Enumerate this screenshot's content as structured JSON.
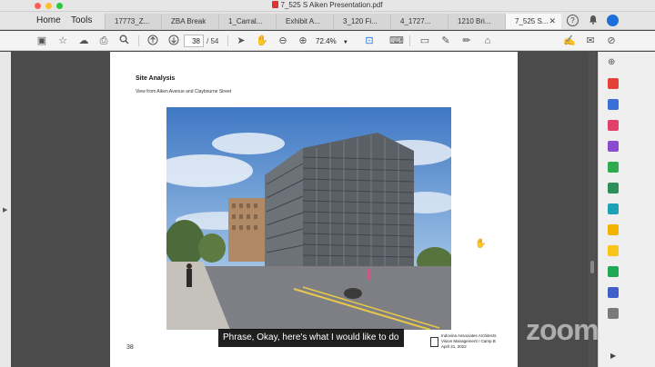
{
  "window": {
    "title": "7_525 S Aiken Presentation.pdf"
  },
  "nav": {
    "home": "Home",
    "tools": "Tools"
  },
  "tabs": [
    {
      "label": "17773_Z..."
    },
    {
      "label": "ZBA Break"
    },
    {
      "label": "1_Carral..."
    },
    {
      "label": "Exhibit A..."
    },
    {
      "label": "3_120 Fi..."
    },
    {
      "label": "4_1727..."
    },
    {
      "label": "1210 Bri..."
    },
    {
      "label": "7_525 S..."
    }
  ],
  "toolbar": {
    "page_current": "38",
    "page_total": "/ 54",
    "zoom": "72.4%"
  },
  "document": {
    "heading": "Site Analysis",
    "subheading": "View from Aiken Avenue and Claybourne Street",
    "page_number": "38",
    "firm_line1": "Indovina Associates Architects",
    "firm_line2": "Vision Management / Camp B",
    "firm_line3": "April 21, 2022"
  },
  "caption": {
    "text": "Phrase, Okay, here's what I would like to do"
  },
  "overlay": {
    "brand": "zoom"
  },
  "colors": {
    "accent": "#1a73e8",
    "acrobat_red": "#d33030"
  }
}
